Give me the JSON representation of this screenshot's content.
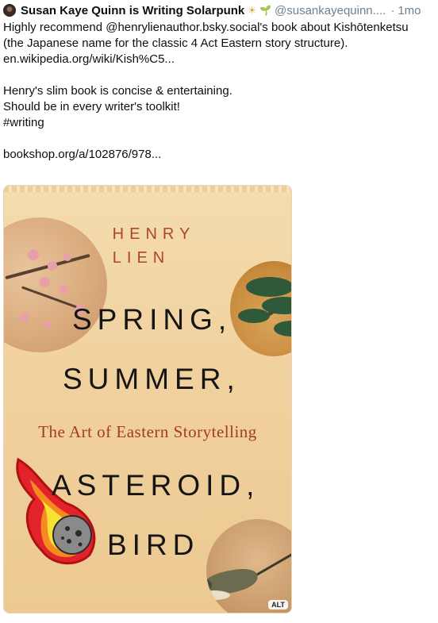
{
  "post": {
    "author": {
      "display_name": "Susan Kaye Quinn is Writing Solarpunk",
      "emoji_1": "☀",
      "emoji_2": "🌱",
      "handle": "@susankayequinn....",
      "separator": "·",
      "time": "1mo"
    },
    "body": {
      "line1": "Highly recommend @henrylienauthor.bsky.social's book about Kishōtenketsu (the Japanese name for the classic 4 Act Eastern story structure).",
      "link1": "en.wikipedia.org/wiki/Kish%C5...",
      "line2": "Henry's slim book is concise & entertaining.",
      "line3": "Should be in every writer's toolkit!",
      "hashtag": "#writing",
      "link2": "bookshop.org/a/102876/978..."
    },
    "image": {
      "alt_badge": "ALT",
      "cover": {
        "author_first": "HENRY",
        "author_last": "LIEN",
        "title_1": "SPRING,",
        "title_2": "SUMMER,",
        "subtitle": "The Art of Eastern Storytelling",
        "title_3": "ASTEROID,",
        "title_4": "BIRD"
      }
    }
  },
  "colors": {
    "text": "#0b0f14",
    "muted": "#6f7f90",
    "cover_background": "#f0d09c",
    "cover_author_red": "#b0432a",
    "cover_title_black": "#151515"
  }
}
